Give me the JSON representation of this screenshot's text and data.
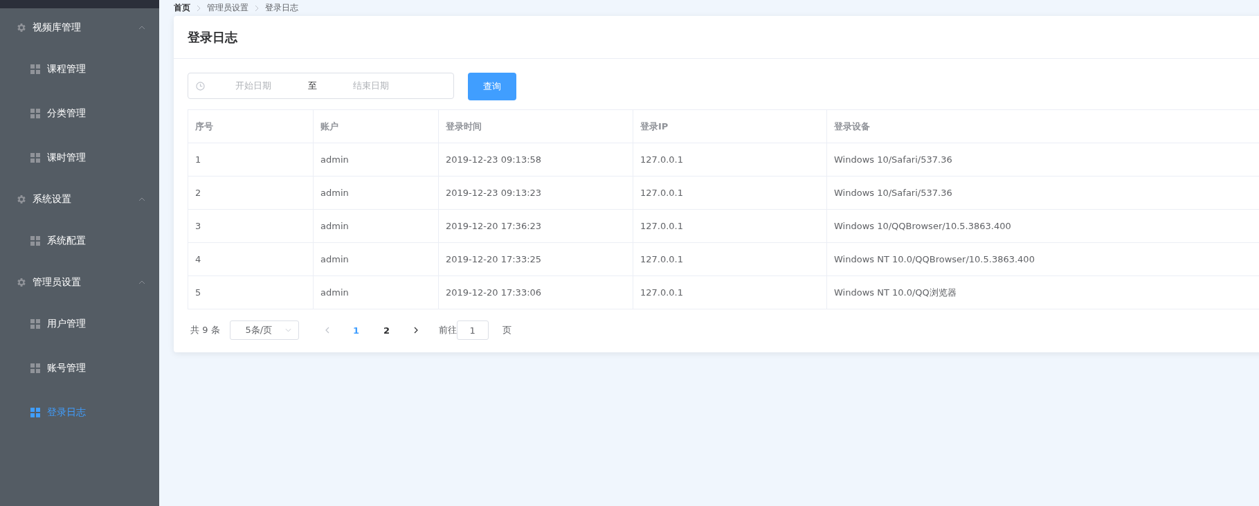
{
  "sidebar": {
    "groups": [
      {
        "label": "视频库管理",
        "expanded": true,
        "children": [
          {
            "label": "课程管理",
            "selected": false
          },
          {
            "label": "分类管理",
            "selected": false
          },
          {
            "label": "课时管理",
            "selected": false
          }
        ]
      },
      {
        "label": "系统设置",
        "expanded": true,
        "children": [
          {
            "label": "系统配置",
            "selected": false
          }
        ]
      },
      {
        "label": "管理员设置",
        "expanded": true,
        "children": [
          {
            "label": "用户管理",
            "selected": false
          },
          {
            "label": "账号管理",
            "selected": false
          },
          {
            "label": "登录日志",
            "selected": true
          }
        ]
      }
    ]
  },
  "breadcrumb": [
    "首页",
    "管理员设置",
    "登录日志"
  ],
  "card": {
    "title": "登录日志",
    "date_range": {
      "start_placeholder": "开始日期",
      "separator": "至",
      "end_placeholder": "结束日期"
    },
    "query_button": "查询",
    "table": {
      "columns": [
        "序号",
        "账户",
        "登录时间",
        "登录IP",
        "登录设备"
      ],
      "rows": [
        [
          "1",
          "admin",
          "2019-12-23 09:13:58",
          "127.0.0.1",
          "Windows 10/Safari/537.36"
        ],
        [
          "2",
          "admin",
          "2019-12-23 09:13:23",
          "127.0.0.1",
          "Windows 10/Safari/537.36"
        ],
        [
          "3",
          "admin",
          "2019-12-20 17:36:23",
          "127.0.0.1",
          "Windows 10/QQBrowser/10.5.3863.400"
        ],
        [
          "4",
          "admin",
          "2019-12-20 17:33:25",
          "127.0.0.1",
          "Windows NT 10.0/QQBrowser/10.5.3863.400"
        ],
        [
          "5",
          "admin",
          "2019-12-20 17:33:06",
          "127.0.0.1",
          "Windows NT 10.0/QQ浏览器"
        ]
      ]
    },
    "pagination": {
      "total": "共 9 条",
      "page_size": "5条/页",
      "pages": [
        {
          "label": "1",
          "selected": true
        },
        {
          "label": "2",
          "selected": false
        }
      ],
      "goto_label": "前往",
      "goto_value": "1",
      "page_suffix": "页"
    }
  }
}
